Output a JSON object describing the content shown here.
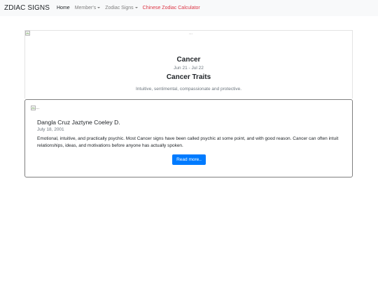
{
  "navbar": {
    "brand": "ZDIAC SIGNS",
    "links": [
      {
        "label": "Home",
        "dropdown": false
      },
      {
        "label": "Member's",
        "dropdown": true
      },
      {
        "label": "Zodiac Signs",
        "dropdown": true
      },
      {
        "label": "Chinese Zodiac Calculator",
        "dropdown": false
      }
    ]
  },
  "sign_card": {
    "image_alt": "...",
    "name": "Cancer",
    "dates": "Jun 21 - Jul 22",
    "traits_title": "Cancer Traits",
    "traits_description": "Intuitive, sentimental, compassionate and protective."
  },
  "post": {
    "image_alt": "...",
    "author": "Dangla Cruz Jaztyne Coeley D.",
    "date": "July 18, 2001",
    "body": "Emotional, intuitive, and practically psychic. Most Cancer signs have been called psychic at some point, and with good reason. Cancer can often intuit relationships, ideas, and motivations before anyone has actually spoken.",
    "read_more_label": "Read more.."
  },
  "colors": {
    "navbar_bg": "#f8f9fa",
    "accent_red": "#dc3545",
    "primary_button": "#007bff",
    "muted_text": "#6c757d"
  }
}
